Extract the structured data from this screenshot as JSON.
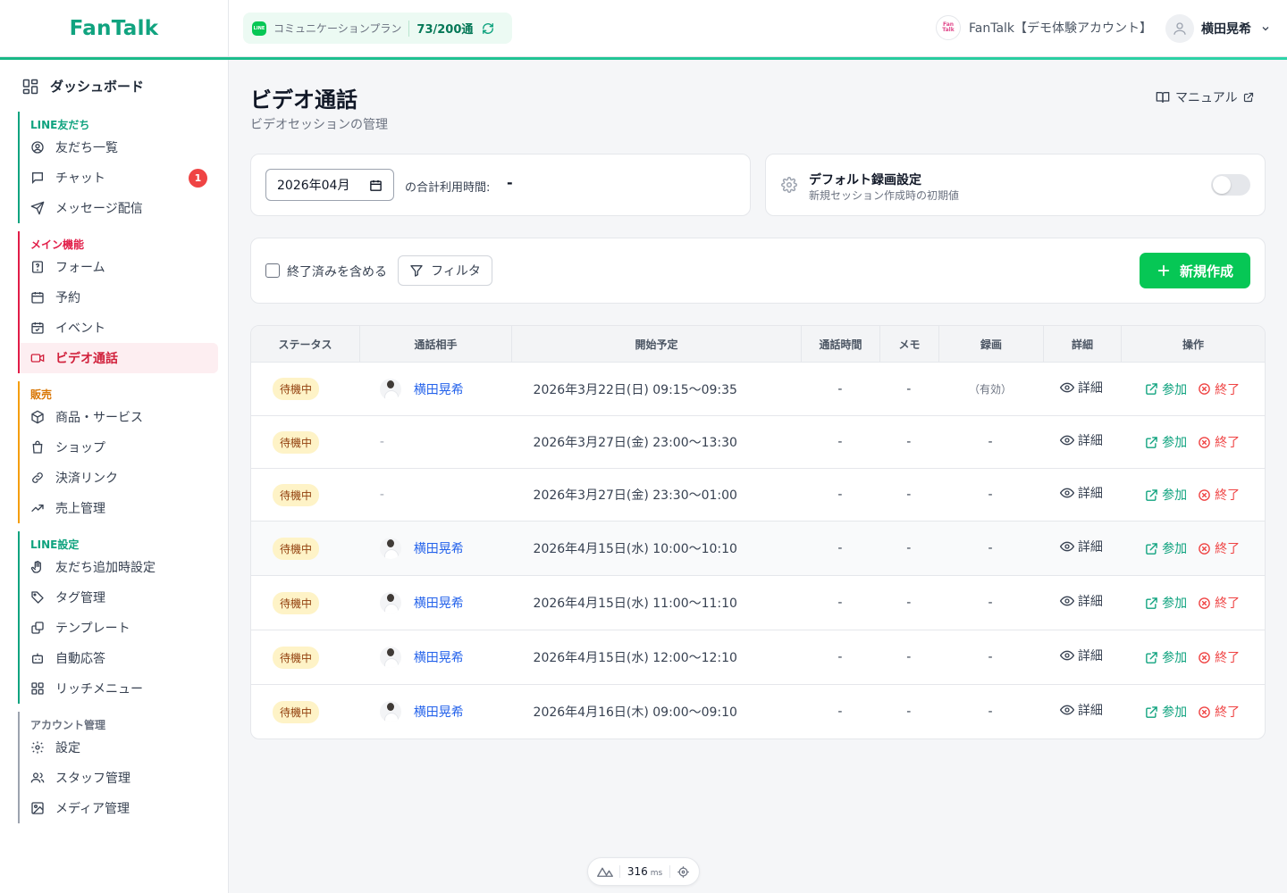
{
  "header": {
    "logo": "FanTalk",
    "plan_icon": "LINE",
    "plan_label": "コミュニケーションプラン",
    "plan_count": "73/200通",
    "account_logo_text": "Fan Talk",
    "account_name": "FanTalk【デモ体験アカウント】",
    "user_name": "横田晃希"
  },
  "sidebar": {
    "dashboard": "ダッシュボード",
    "groups": [
      {
        "title": "LINE友だち",
        "color": "#10a37f",
        "items": [
          {
            "label": "友だち一覧",
            "icon": "user-circle-icon"
          },
          {
            "label": "チャット",
            "icon": "chat-icon",
            "badge": "1"
          },
          {
            "label": "メッセージ配信",
            "icon": "send-icon"
          }
        ]
      },
      {
        "title": "メイン機能",
        "color": "#e11d48",
        "items": [
          {
            "label": "フォーム",
            "icon": "form-icon"
          },
          {
            "label": "予約",
            "icon": "calendar-icon"
          },
          {
            "label": "イベント",
            "icon": "calendar-check-icon"
          },
          {
            "label": "ビデオ通話",
            "icon": "video-icon",
            "active": true
          }
        ]
      },
      {
        "title": "販売",
        "color": "#d97706",
        "items": [
          {
            "label": "商品・サービス",
            "icon": "package-icon"
          },
          {
            "label": "ショップ",
            "icon": "shopping-bag-icon"
          },
          {
            "label": "決済リンク",
            "icon": "link-icon"
          },
          {
            "label": "売上管理",
            "icon": "trending-up-icon"
          }
        ]
      },
      {
        "title": "LINE設定",
        "color": "#10a37f",
        "items": [
          {
            "label": "友だち追加時設定",
            "icon": "hand-icon"
          },
          {
            "label": "タグ管理",
            "icon": "tag-icon"
          },
          {
            "label": "テンプレート",
            "icon": "template-icon"
          },
          {
            "label": "自動応答",
            "icon": "bot-icon"
          },
          {
            "label": "リッチメニュー",
            "icon": "grid-icon"
          }
        ]
      },
      {
        "title": "アカウント管理",
        "color": "#6b7280",
        "items": [
          {
            "label": "設定",
            "icon": "gear-icon"
          },
          {
            "label": "スタッフ管理",
            "icon": "users-icon"
          },
          {
            "label": "メディア管理",
            "icon": "image-icon"
          }
        ]
      }
    ]
  },
  "page": {
    "title": "ビデオ通話",
    "subtitle": "ビデオセッションの管理",
    "manual": "マニュアル"
  },
  "usage": {
    "month": "2026年04月",
    "total_label": "の合計利用時間:",
    "total_value": "-"
  },
  "recording": {
    "title": "デフォルト録画設定",
    "subtitle": "新規セッション作成時の初期値",
    "enabled": false
  },
  "toolbar": {
    "include_finished": "終了済みを含める",
    "filter": "フィルタ",
    "new": "新規作成"
  },
  "table": {
    "headers": [
      "ステータス",
      "通話相手",
      "開始予定",
      "通話時間",
      "メモ",
      "録画",
      "詳細",
      "操作"
    ],
    "detail_label": "詳細",
    "join_label": "参加",
    "end_label": "終了",
    "rows": [
      {
        "status": "待機中",
        "partner": "横田晃希",
        "start": "2026年3月22日(日) 09:15〜09:35",
        "duration": "-",
        "memo": "-",
        "recording": "（有効）"
      },
      {
        "status": "待機中",
        "partner": "-",
        "start": "2026年3月27日(金) 23:00〜13:30",
        "duration": "-",
        "memo": "-",
        "recording": "-"
      },
      {
        "status": "待機中",
        "partner": "-",
        "start": "2026年3月27日(金) 23:30〜01:00",
        "duration": "-",
        "memo": "-",
        "recording": "-"
      },
      {
        "status": "待機中",
        "partner": "横田晃希",
        "start": "2026年4月15日(水) 10:00〜10:10",
        "duration": "-",
        "memo": "-",
        "recording": "-"
      },
      {
        "status": "待機中",
        "partner": "横田晃希",
        "start": "2026年4月15日(水) 11:00〜11:10",
        "duration": "-",
        "memo": "-",
        "recording": "-"
      },
      {
        "status": "待機中",
        "partner": "横田晃希",
        "start": "2026年4月15日(水) 12:00〜12:10",
        "duration": "-",
        "memo": "-",
        "recording": "-"
      },
      {
        "status": "待機中",
        "partner": "横田晃希",
        "start": "2026年4月16日(木) 09:00〜09:10",
        "duration": "-",
        "memo": "-",
        "recording": "-"
      }
    ]
  },
  "perf": {
    "value": "316",
    "unit": "ms"
  }
}
